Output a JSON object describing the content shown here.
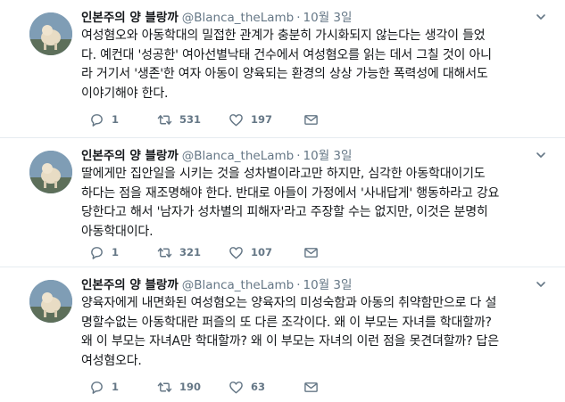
{
  "tweets": [
    {
      "name": "인본주의 양 블랑까",
      "handle": "@Blanca_theLamb",
      "separator": "·",
      "date": "10월 3일",
      "lines": [
        "여성혐오와 아동학대의 밀접한 관계가 충분히 가시화되지 않는다는 생각이 들었",
        "다. 예컨대 '성공한' 여아선별낙태 건수에서 여성혐오를 읽는 데서 그칠 것이 아니",
        "라 거기서 '생존'한 여자 아동이 양육되는 환경의 상상 가능한 폭력성에 대해서도",
        "이야기해야 한다."
      ],
      "replies": "1",
      "retweets": "531",
      "likes": "197"
    },
    {
      "name": "인본주의 양 블랑까",
      "handle": "@Blanca_theLamb",
      "separator": "·",
      "date": "10월 3일",
      "lines": [
        "딸에게만 집안일을 시키는 것을 성차별이라고만 하지만, 심각한 아동학대이기도",
        "하다는 점을 재조명해야 한다. 반대로 아들이 가정에서 '사내답게' 행동하라고 강요",
        "당한다고 해서 '남자가 성차별의 피해자'라고 주장할 수는 없지만, 이것은 분명히",
        "아동학대이다."
      ],
      "replies": "1",
      "retweets": "321",
      "likes": "107"
    },
    {
      "name": "인본주의 양 블랑까",
      "handle": "@Blanca_theLamb",
      "separator": "·",
      "date": "10월 3일",
      "lines": [
        "양육자에게 내면화된 여성혐오는 양육자의 미성숙함과 아동의 취약함만으로 다 설",
        "명할수없는 아동학대란 퍼즐의 또 다른 조각이다. 왜 이 부모는 자녀를 학대할까?",
        "왜 이 부모는 자녀A만 학대할까? 왜 이 부모는 자녀의 이런 점을 못견뎌할까? 답은",
        "여성혐오다."
      ],
      "replies": "1",
      "retweets": "190",
      "likes": "63"
    }
  ],
  "icons": {
    "reply": "reply-icon",
    "retweet": "retweet-icon",
    "like": "heart-icon",
    "dm": "envelope-icon",
    "caret": "chevron-down-icon"
  },
  "colors": {
    "text": "#14171a",
    "secondary": "#657786",
    "divider": "#e6ecf0"
  }
}
